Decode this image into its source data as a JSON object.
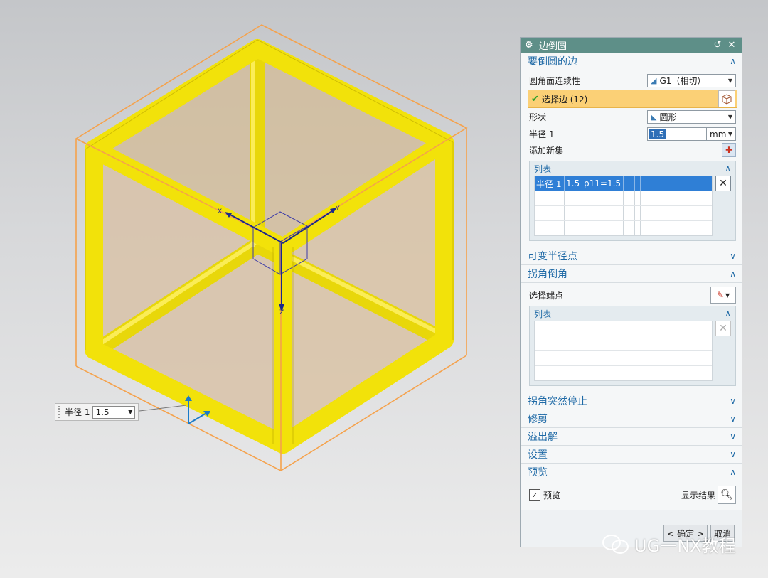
{
  "viewport": {
    "axis_labels": [
      "X",
      "Y",
      "Z"
    ],
    "floating_input": {
      "label": "半径 1",
      "value": "1.5"
    }
  },
  "dialog": {
    "title": "边倒圆",
    "sections": {
      "edges": {
        "header": "要倒圆的边",
        "continuity_label": "圆角面连续性",
        "continuity_value": "G1（相切）",
        "select_label": "选择边 (12)",
        "shape_label": "形状",
        "shape_value": "圆形",
        "radius_label": "半径 1",
        "radius_value": "1.5",
        "radius_unit": "mm",
        "add_new_set_label": "添加新集",
        "list": {
          "header": "列表",
          "rows": [
            {
              "name": "半径 1",
              "value": "1.5",
              "expr": "p11=1.5"
            }
          ]
        }
      },
      "variable_radius": {
        "header": "可变半径点"
      },
      "corner_setback": {
        "header": "拐角倒角",
        "select_endpoint_label": "选择端点",
        "list_header": "列表"
      },
      "corner_stop": {
        "header": "拐角突然停止"
      },
      "trim": {
        "header": "修剪"
      },
      "overflow": {
        "header": "溢出解"
      },
      "settings": {
        "header": "设置"
      },
      "preview": {
        "header": "预览",
        "preview_checkbox_label": "预览",
        "show_result_label": "显示结果"
      }
    },
    "buttons": {
      "ok": "< 确定 >",
      "cancel": "取消"
    }
  },
  "watermark": {
    "text": "UG一NX教程"
  },
  "colors": {
    "titlebar": "#5e8f88",
    "section_header_text": "#1f6aa6",
    "selection_highlight": "#fbd076",
    "edge_blend_yellow": "#f2e20a",
    "bounding_box_orange": "#f5a24c"
  }
}
